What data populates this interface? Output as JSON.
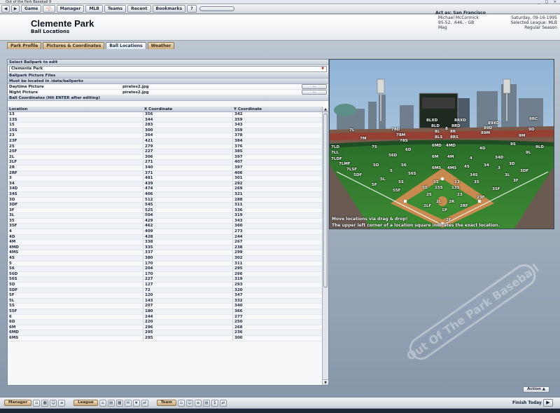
{
  "window": {
    "title": "Out of the Park Baseball 9"
  },
  "menu": {
    "back": "◀",
    "forward": "▶",
    "items": [
      "Game",
      "⚾",
      "Manager",
      "MLB",
      "Teams",
      "Recent",
      "Bookmarks",
      "?"
    ],
    "act_as": "Act as: San Francisco"
  },
  "header": {
    "title": "Clemente Park",
    "subtitle": "Ball Locations",
    "manager_lines": [
      "Michael McCormick",
      "95-52, .646, - GB",
      "Mag"
    ],
    "date_lines": [
      "Saturday, 09-16-1995",
      "Selected League: MLB",
      "Regular Season"
    ]
  },
  "tabs": [
    "Park Profile",
    "Pictures & Coordinates",
    "Ball Locations",
    "Weather"
  ],
  "active_tab": 2,
  "editor": {
    "select_label": "Select Ballpark to edit",
    "selected_park": "Clemente Park",
    "pictures_label": "Ballpark Picture Files",
    "location_note": "Must be located in /data/ballparks",
    "day_label": "Daytime Picture",
    "day_file": "pirates2.jpg",
    "night_label": "Night Picture",
    "night_file": "pirates2.jpg",
    "browse_label": "...",
    "coords_label": "Ball Coordinates (Hit ENTER after editing)",
    "columns": [
      "Location",
      "X Coordinate",
      "Y Coordinate"
    ],
    "rows": [
      [
        "13",
        "356",
        "342"
      ],
      [
        "13S",
        "344",
        "359"
      ],
      [
        "15",
        "283",
        "343"
      ],
      [
        "15S",
        "300",
        "359"
      ],
      [
        "23",
        "364",
        "378"
      ],
      [
        "23F",
        "421",
        "384"
      ],
      [
        "25",
        "279",
        "376"
      ],
      [
        "25F",
        "227",
        "385"
      ],
      [
        "2L",
        "306",
        "397"
      ],
      [
        "2LF",
        "271",
        "407"
      ],
      [
        "2R",
        "340",
        "397"
      ],
      [
        "2RF",
        "371",
        "406"
      ],
      [
        "3",
        "481",
        "301"
      ],
      [
        "34",
        "439",
        "292"
      ],
      [
        "34D",
        "474",
        "269"
      ],
      [
        "34S",
        "406",
        "321"
      ],
      [
        "3D",
        "512",
        "288"
      ],
      [
        "3DF",
        "545",
        "311"
      ],
      [
        "3F",
        "525",
        "336"
      ],
      [
        "3L",
        "504",
        "319"
      ],
      [
        "35",
        "429",
        "343"
      ],
      [
        "35F",
        "462",
        "360"
      ],
      [
        "4",
        "409",
        "273"
      ],
      [
        "4D",
        "428",
        "244"
      ],
      [
        "4M",
        "338",
        "267"
      ],
      [
        "4MD",
        "335",
        "238"
      ],
      [
        "4MS",
        "337",
        "299"
      ],
      [
        "4S",
        "380",
        "302"
      ],
      [
        "5",
        "170",
        "311"
      ],
      [
        "56",
        "204",
        "295"
      ],
      [
        "56D",
        "170",
        "266"
      ],
      [
        "56S",
        "227",
        "319"
      ],
      [
        "5D",
        "127",
        "293"
      ],
      [
        "5DF",
        "72",
        "320"
      ],
      [
        "5F",
        "120",
        "347"
      ],
      [
        "5L",
        "143",
        "332"
      ],
      [
        "5S",
        "207",
        "340"
      ],
      [
        "55F",
        "180",
        "366"
      ],
      [
        "6",
        "244",
        "277"
      ],
      [
        "6D",
        "220",
        "250"
      ],
      [
        "6M",
        "296",
        "268"
      ],
      [
        "6MD",
        "295",
        "236"
      ],
      [
        "6MS",
        "295",
        "300"
      ]
    ]
  },
  "field": {
    "hint_line1": "Move locations via drag & drop!",
    "hint_line2": "The upper left corner of a location square indicates the exact location.",
    "labels": [
      "7LD",
      "7LL",
      "7LDF",
      "7LMF",
      "7LSF",
      "7L",
      "7M",
      "78D",
      "78M",
      "78S",
      "7S",
      "8LXD",
      "8LD",
      "8L",
      "8LS",
      "8",
      "8RXD",
      "8RD",
      "8R",
      "8RS",
      "89XD",
      "89M",
      "89D",
      "9M",
      "9D",
      "9RC",
      "9LD",
      "9L",
      "9S",
      "4MD",
      "6MD",
      "6M",
      "4M",
      "56D",
      "6D",
      "5D",
      "5DF",
      "5",
      "56",
      "56S",
      "6MS",
      "4MS",
      "34S",
      "4S",
      "34",
      "3",
      "3D",
      "3DF",
      "34D",
      "4D",
      "4",
      "3F",
      "35F",
      "3L",
      "5L",
      "5F",
      "5S",
      "55F",
      "15S",
      "13S",
      "35",
      "15",
      "13",
      "25",
      "23",
      "2LF",
      "2L",
      "2R",
      "2RF",
      "23F",
      "2F",
      "1P",
      "5S"
    ],
    "brand_text": "Out Of The Park Baseball"
  },
  "bottom": {
    "manager_label": "Manager",
    "league_label": "League",
    "team_label": "Team",
    "finish_label": "Finish Today",
    "action_label": "Action ▲"
  },
  "colors": {
    "tab_tan": "#c9a97a",
    "panel_blue": "#c5cfdb",
    "grass": "#2f7a2b",
    "dirt": "#c88a4e"
  }
}
